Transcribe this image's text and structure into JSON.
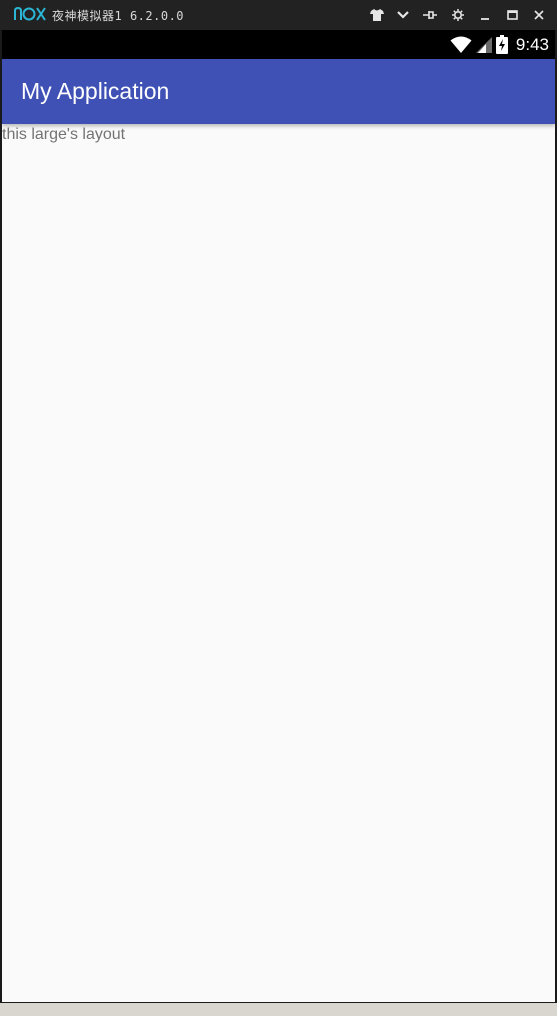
{
  "window": {
    "title": "夜神模拟器1 6.2.0.0",
    "logo_icon": "nox-logo",
    "controls": [
      {
        "name": "shirt-icon"
      },
      {
        "name": "chevron-down-icon"
      },
      {
        "name": "pin-icon"
      },
      {
        "name": "gear-icon"
      },
      {
        "name": "minimize-icon"
      },
      {
        "name": "maximize-icon"
      },
      {
        "name": "close-icon"
      }
    ],
    "logo_color": "#2bb6d6"
  },
  "statusbar": {
    "time": "9:43",
    "icons": [
      "wifi-icon",
      "signal-icon",
      "battery-charging-icon"
    ]
  },
  "appbar": {
    "title": "My Application",
    "color": "#3f51b5"
  },
  "content": {
    "text": "this large's layout"
  }
}
